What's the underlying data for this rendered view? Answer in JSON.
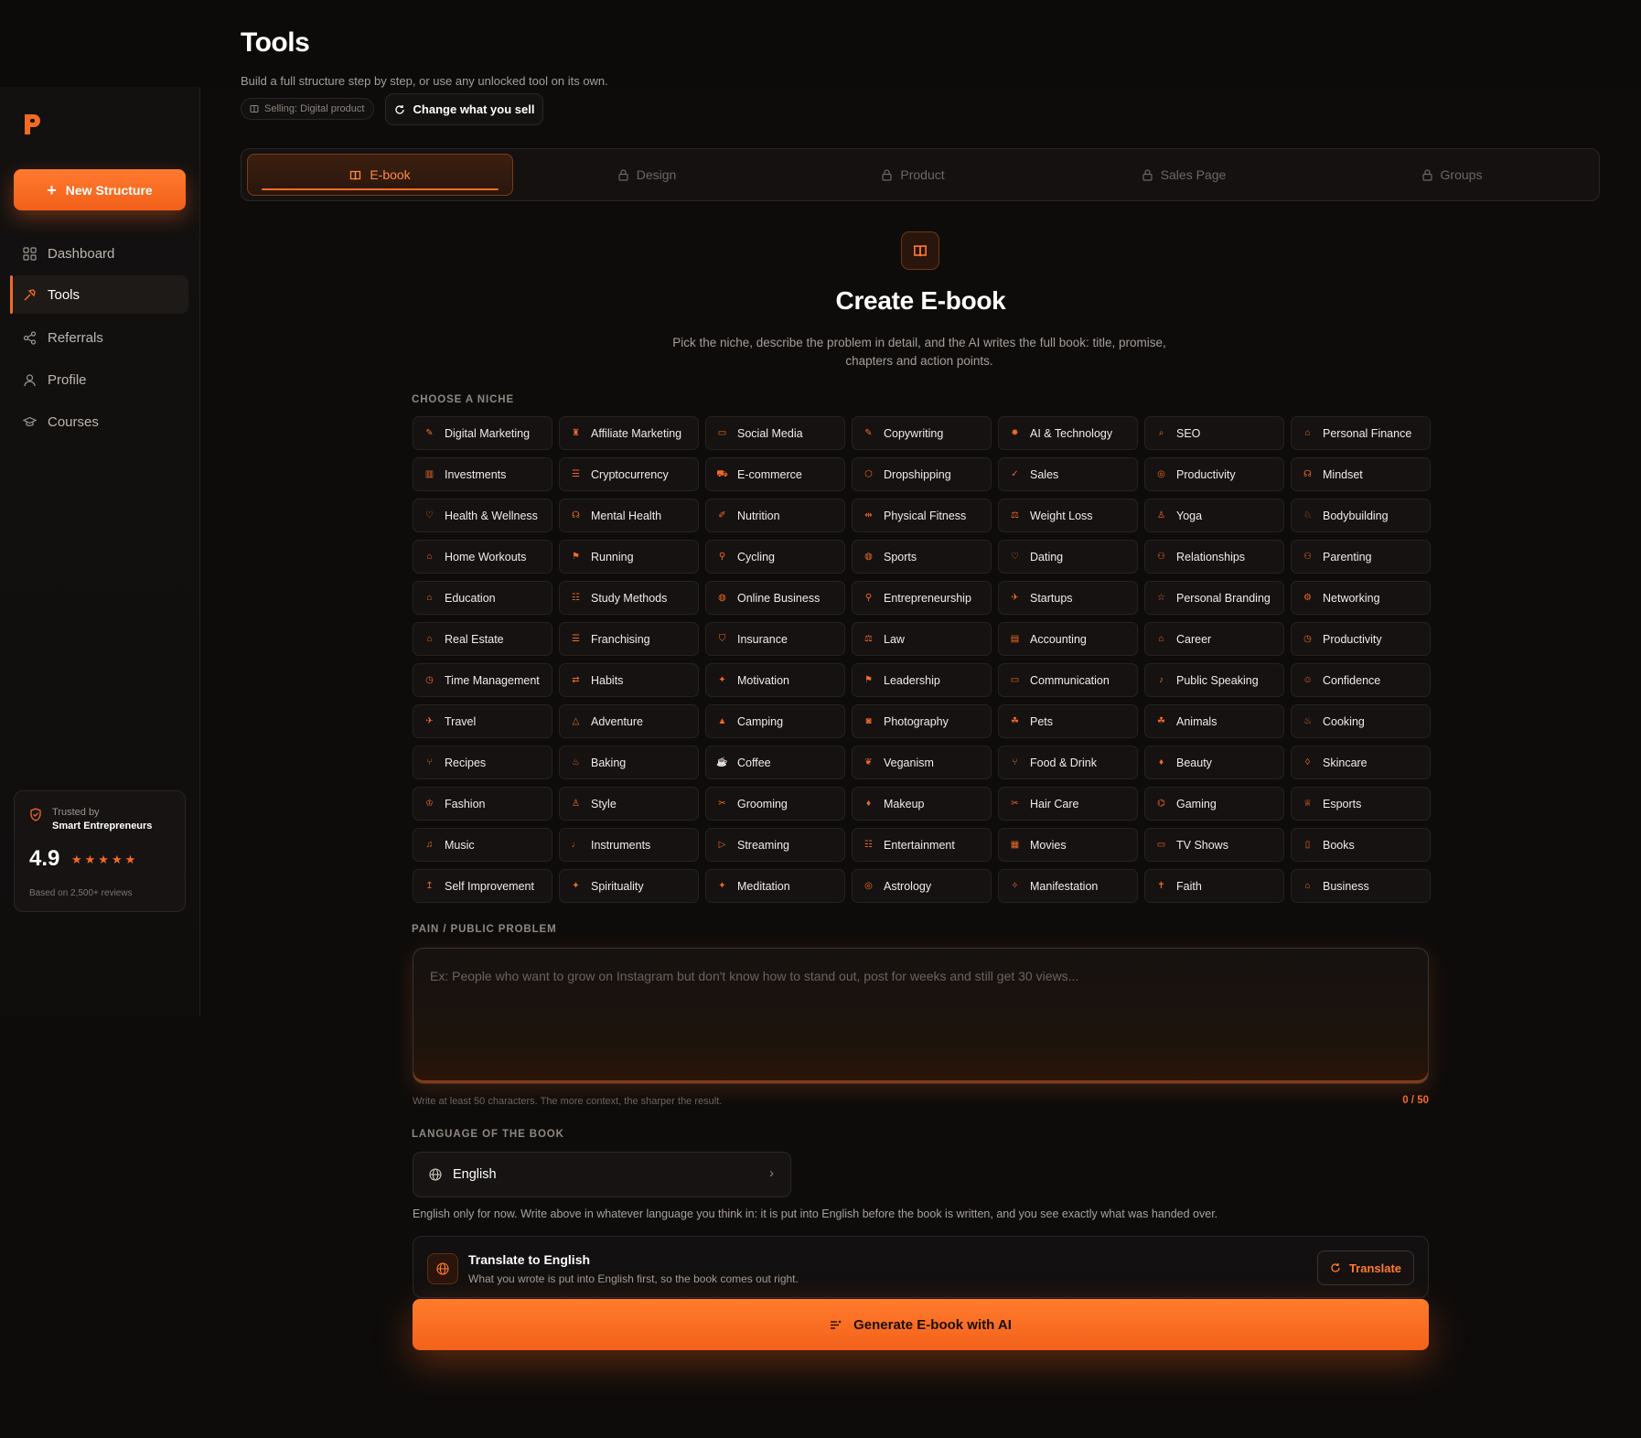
{
  "header": {
    "title": "Tools",
    "subtitle": "Build a full structure step by step, or use any unlocked tool on its own.",
    "selling_chip": "Selling: Digital product",
    "change_button": "Change what you sell"
  },
  "sidebar": {
    "new_button": "New Structure",
    "items": [
      {
        "label": "Dashboard",
        "icon": "grid-icon"
      },
      {
        "label": "Tools",
        "icon": "hammer-icon",
        "active": true
      },
      {
        "label": "Referrals",
        "icon": "share-icon"
      },
      {
        "label": "Profile",
        "icon": "user-icon"
      },
      {
        "label": "Courses",
        "icon": "graduation-cap-icon"
      }
    ],
    "trust": {
      "label": "Trusted by",
      "strong": "Smart Entrepreneurs",
      "score": "4.9",
      "stars": "★★★★★",
      "footer": "Based on 2,500+ reviews"
    }
  },
  "tabs": [
    {
      "label": "E-book",
      "active": true,
      "locked": false
    },
    {
      "label": "Design",
      "locked": true
    },
    {
      "label": "Product",
      "locked": true
    },
    {
      "label": "Sales Page",
      "locked": true
    },
    {
      "label": "Groups",
      "locked": true
    }
  ],
  "hero": {
    "title": "Create E-book",
    "description": "Pick the niche, describe the problem in detail, and the AI writes the full book: title, promise, chapters and action points."
  },
  "niche_section": {
    "label": "CHOOSE A NICHE",
    "items": [
      "Digital Marketing",
      "Affiliate Marketing",
      "Social Media",
      "Copywriting",
      "AI & Technology",
      "SEO",
      "Personal Finance",
      "Investments",
      "Cryptocurrency",
      "E-commerce",
      "Dropshipping",
      "Sales",
      "Productivity",
      "Mindset",
      "Health & Wellness",
      "Mental Health",
      "Nutrition",
      "Physical Fitness",
      "Weight Loss",
      "Yoga",
      "Bodybuilding",
      "Home Workouts",
      "Running",
      "Cycling",
      "Sports",
      "Dating",
      "Relationships",
      "Parenting",
      "Education",
      "Study Methods",
      "Online Business",
      "Entrepreneurship",
      "Startups",
      "Personal Branding",
      "Networking",
      "Real Estate",
      "Franchising",
      "Insurance",
      "Law",
      "Accounting",
      "Career",
      "Productivity",
      "Time Management",
      "Habits",
      "Motivation",
      "Leadership",
      "Communication",
      "Public Speaking",
      "Confidence",
      "Travel",
      "Adventure",
      "Camping",
      "Photography",
      "Pets",
      "Animals",
      "Cooking",
      "Recipes",
      "Baking",
      "Coffee",
      "Veganism",
      "Food & Drink",
      "Beauty",
      "Skincare",
      "Fashion",
      "Style",
      "Grooming",
      "Makeup",
      "Hair Care",
      "Gaming",
      "Esports",
      "Music",
      "Instruments",
      "Streaming",
      "Entertainment",
      "Movies",
      "TV Shows",
      "Books",
      "Self Improvement",
      "Spirituality",
      "Meditation",
      "Astrology",
      "Manifestation",
      "Faith",
      "Business"
    ],
    "icons": [
      "✎",
      "♜",
      "▭",
      "✎",
      "✸",
      "⌕",
      "⌂",
      "▥",
      "☰",
      "⛟",
      "⬡",
      "✓",
      "◎",
      "☊",
      "♡",
      "☊",
      "✐",
      "⇹",
      "⚖",
      "♙",
      "♘",
      "⌂",
      "⚑",
      "⚲",
      "◍",
      "♡",
      "⚇",
      "⚇",
      "⌂",
      "☷",
      "◍",
      "⚲",
      "✈",
      "☆",
      "⚙",
      "⌂",
      "☰",
      "⛉",
      "⚖",
      "▤",
      "⌂",
      "◷",
      "◷",
      "⇄",
      "✦",
      "⚑",
      "▭",
      "♪",
      "☺",
      "✈",
      "△",
      "▲",
      "◙",
      "☘",
      "☘",
      "♨",
      "⑂",
      "♨",
      "☕",
      "❦",
      "⑂",
      "♦",
      "◊",
      "♔",
      "♙",
      "✂",
      "♦",
      "✂",
      "⌬",
      "♕",
      "♫",
      "♩",
      "▷",
      "☷",
      "▦",
      "▭",
      "▯",
      "↥",
      "✦",
      "✦",
      "◎",
      "✧",
      "✝",
      "⌂"
    ]
  },
  "problem_section": {
    "label": "PAIN / PUBLIC PROBLEM",
    "placeholder": "Ex: People who want to grow on Instagram but don't know how to stand out, post for weeks and still get 30 views...",
    "hint": "Write at least 50 characters. The more context, the sharper the result.",
    "counter": "0 / 50"
  },
  "language_section": {
    "label": "LANGUAGE OF THE BOOK",
    "value": "English",
    "note": "English only for now. Write above in whatever language you think in: it is put into English before the book is written, and you see exactly what was handed over."
  },
  "translate": {
    "title": "Translate to English",
    "subtitle": "What you wrote is put into English first, so the book comes out right.",
    "button": "Translate"
  },
  "generate_button": "Generate E-book with AI",
  "colors": {
    "accent": "#f26a25",
    "background": "#0e0c0b"
  }
}
